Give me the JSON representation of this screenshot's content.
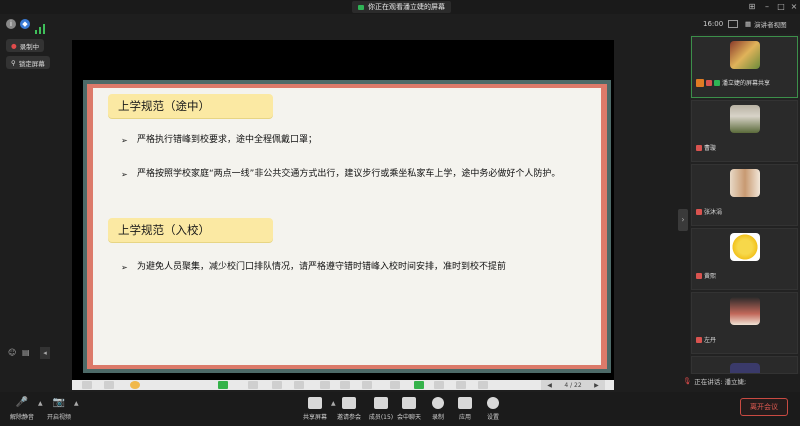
{
  "window": {
    "share_banner": "你正在观看潘立婕的屏幕"
  },
  "topbar": {
    "time": "16:00",
    "speaker_view": "演讲者视图"
  },
  "left_controls": {
    "recording": "录制中",
    "lock_screen": "锁定屏幕"
  },
  "slide": {
    "section1_title": "上学规范（途中）",
    "section1_bullets": [
      "严格执行错峰到校要求，途中全程佩戴口罩；",
      "严格按照学校家庭“两点一线”非公共交通方式出行，建议步行或乘坐私家车上学，途中务必做好个人防护。"
    ],
    "section2_title": "上学规范（入校）",
    "section2_bullets": [
      "为避免人员聚集，减少校门口排队情况，请严格遵守错时错峰入校时间安排，准时到校不提前"
    ],
    "page_indicator": "4 / 22"
  },
  "participants": [
    {
      "name": "潘立婕的屏幕共享",
      "avatar": "flowers",
      "muted": true
    },
    {
      "name": "曹璇",
      "avatar": "person",
      "muted": true
    },
    {
      "name": "张沐涓",
      "avatar": "people",
      "muted": true
    },
    {
      "name": "黄熙",
      "avatar": "lemon",
      "muted": true
    },
    {
      "name": "左丹",
      "avatar": "dark-photo",
      "muted": true
    }
  ],
  "speaking": {
    "label": "正在讲话: 潘立婕;"
  },
  "bottom_bar": {
    "unmute": "解除静音",
    "start_video": "开启视频",
    "share_screen": "共享屏幕",
    "invite": "邀请参会",
    "members": "成员(15)",
    "chat": "会中聊天",
    "record": "录制",
    "apps": "应用",
    "settings": "设置",
    "leave": "离开会议"
  },
  "colors": {
    "slide_outer": "#4d6a68",
    "slide_border": "#dc7a6a",
    "heading_bg": "#fbe9a3",
    "leave_red": "#e25b52"
  }
}
